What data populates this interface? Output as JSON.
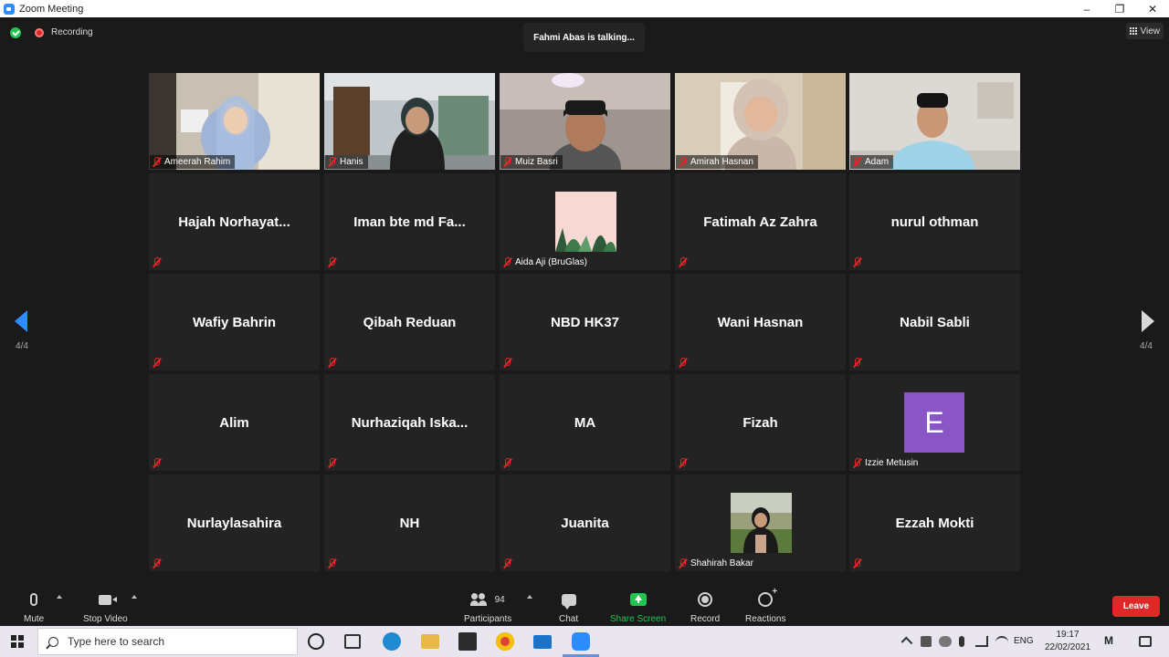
{
  "window": {
    "title": "Zoom Meeting",
    "controls": [
      "–",
      "❐",
      "✕"
    ]
  },
  "topbar": {
    "recording_label": "Recording",
    "talking": "Fahmi Abas is talking...",
    "view_label": "View"
  },
  "pagination": {
    "left": "4/4",
    "right": "4/4"
  },
  "tiles": [
    {
      "name": "Ameerah Rahim",
      "video": true
    },
    {
      "name": "Hanis",
      "video": true
    },
    {
      "name": "Muiz Basri",
      "video": true
    },
    {
      "name": "Amirah Hasnan",
      "video": true
    },
    {
      "name": "Adam",
      "video": true
    },
    {
      "name": "Hajah  Norhayat...",
      "video": false
    },
    {
      "name": "Iman  bte  md  Fa...",
      "video": false
    },
    {
      "name": "Aida Aji (BruGlas)",
      "video": false,
      "avatar": "image"
    },
    {
      "name": "Fatimah Az Zahra",
      "video": false
    },
    {
      "name": "nurul othman",
      "video": false
    },
    {
      "name": "Wafiy Bahrin",
      "video": false
    },
    {
      "name": "Qibah Reduan",
      "video": false
    },
    {
      "name": "NBD HK37",
      "video": false
    },
    {
      "name": "Wani Hasnan",
      "video": false
    },
    {
      "name": "Nabil Sabli",
      "video": false
    },
    {
      "name": "Alim",
      "video": false
    },
    {
      "name": "Nurhaziqah  Iska...",
      "video": false
    },
    {
      "name": "MA",
      "video": false
    },
    {
      "name": "Fizah",
      "video": false
    },
    {
      "name": "Izzie Metusin",
      "video": false,
      "avatar": "letter",
      "letter": "E"
    },
    {
      "name": "Nurlaylasahira",
      "video": false
    },
    {
      "name": "NH",
      "video": false
    },
    {
      "name": "Juanita",
      "video": false
    },
    {
      "name": "Shahirah Bakar",
      "video": false,
      "avatar": "image"
    },
    {
      "name": "Ezzah Mokti",
      "video": false
    }
  ],
  "controls": {
    "mute": "Mute",
    "stop_video": "Stop Video",
    "participants": "Participants",
    "participants_count": "94",
    "chat": "Chat",
    "share_screen": "Share Screen",
    "record": "Record",
    "reactions": "Reactions",
    "leave": "Leave"
  },
  "taskbar": {
    "search_placeholder": "Type here to search",
    "lang": "ENG",
    "time": "19:17",
    "date": "22/02/2021"
  },
  "colors": {
    "accent": "#2d8cff",
    "leave": "#e02828",
    "share": "#23c552",
    "tile_bg": "#232323"
  }
}
